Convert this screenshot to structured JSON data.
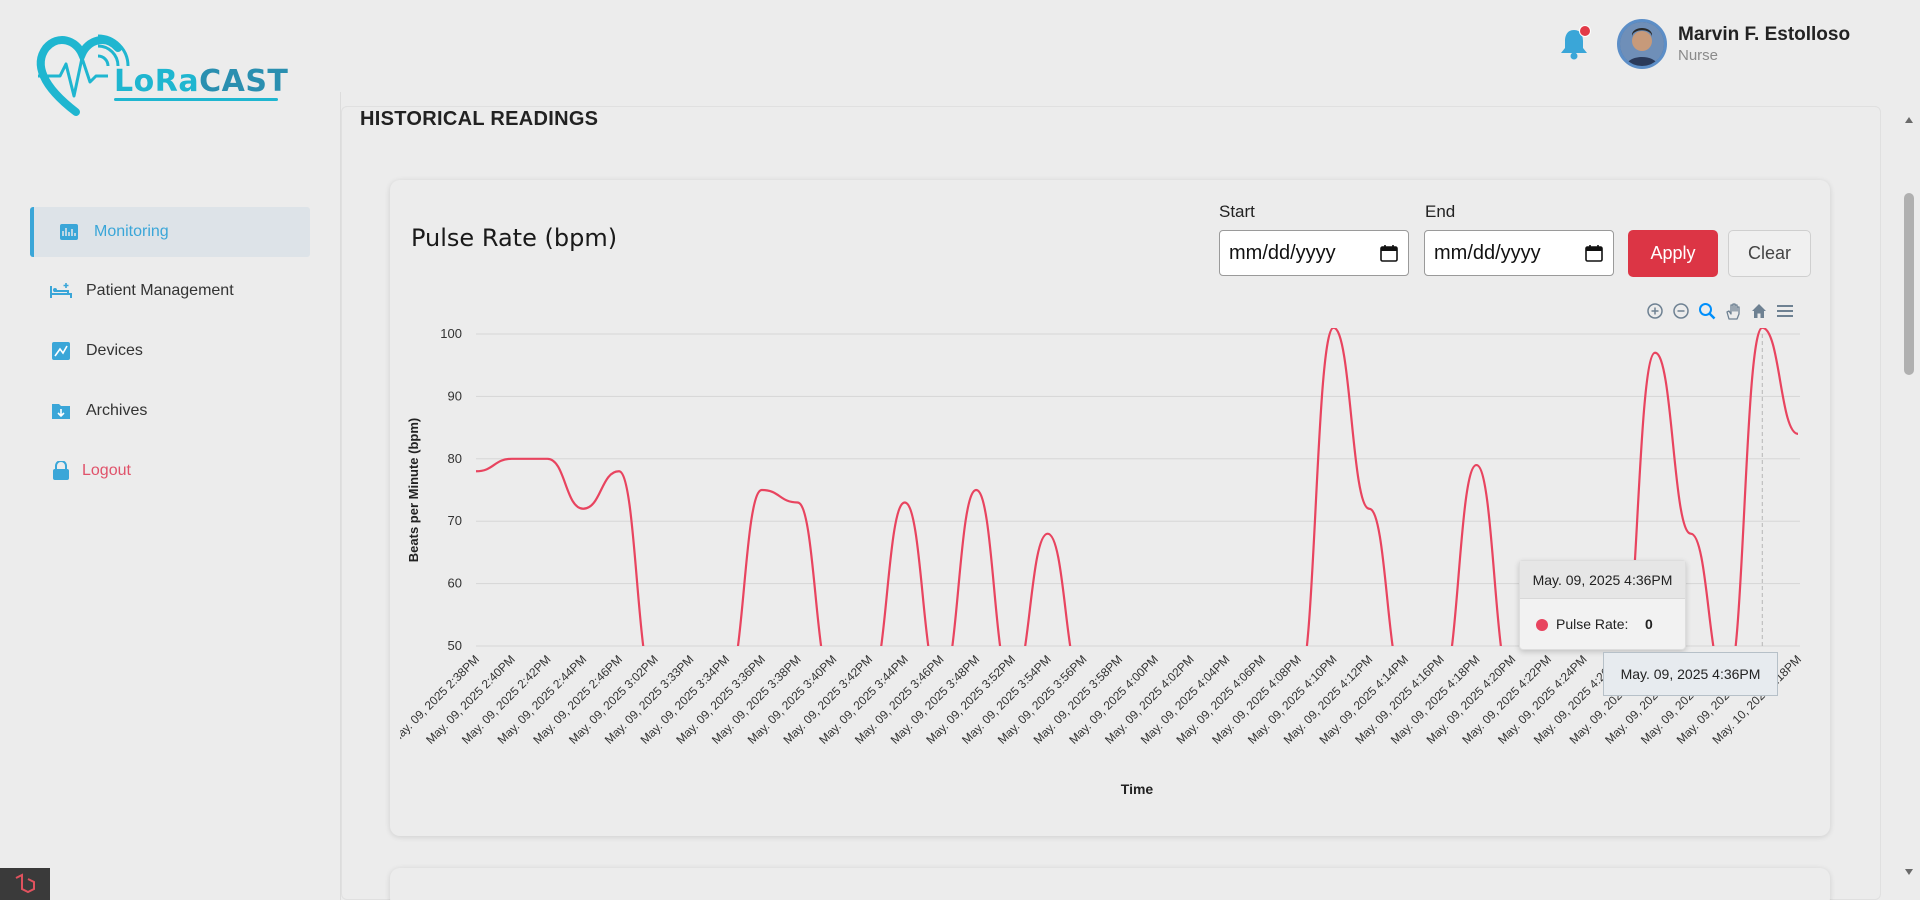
{
  "brand": {
    "name_part1": "LoRa",
    "name_part2": "CAST"
  },
  "sidebar": {
    "items": [
      {
        "label": "Monitoring",
        "icon": "monitor-chart-icon",
        "active": true
      },
      {
        "label": "Patient Management",
        "icon": "bed-plus-icon"
      },
      {
        "label": "Devices",
        "icon": "devices-icon"
      },
      {
        "label": "Archives",
        "icon": "archive-icon"
      },
      {
        "label": "Logout",
        "icon": "lock-icon"
      }
    ]
  },
  "header": {
    "user_name": "Marvin F. Estolloso",
    "user_role": "Nurse",
    "notification_icon": "bell-icon",
    "notification_badge_color": "#e23a48"
  },
  "section": {
    "title": "HISTORICAL READINGS"
  },
  "card": {
    "title": "Pulse Rate (bpm)",
    "start_label": "Start",
    "end_label": "End",
    "start_placeholder": "mm/dd/yyyy",
    "end_placeholder": "mm/dd/yyyy",
    "apply_label": "Apply",
    "clear_label": "Clear",
    "apply_color": "#dc3545"
  },
  "toolbar": [
    "zoom-in-icon",
    "zoom-out-icon",
    "zoom-selection-icon",
    "pan-hand-icon",
    "home-reset-icon",
    "menu-icon"
  ],
  "tooltip": {
    "title": "May. 09, 2025 4:36PM",
    "series_label": "Pulse Rate:",
    "value": "0",
    "x_label": "May. 09, 2025 4:36PM"
  },
  "chart_data": {
    "type": "line",
    "title": "",
    "xlabel": "Time",
    "ylabel": "Beats per Minute (bpm)",
    "ylim": [
      50,
      100
    ],
    "yticks": [
      50,
      60,
      70,
      80,
      90,
      100
    ],
    "grid": true,
    "line_color": "#e8445f",
    "categories": [
      "May. 09, 2025 2:38PM",
      "May. 09, 2025 2:40PM",
      "May. 09, 2025 2:42PM",
      "May. 09, 2025 2:44PM",
      "May. 09, 2025 2:46PM",
      "May. 09, 2025 3:02PM",
      "May. 09, 2025 3:33PM",
      "May. 09, 2025 3:34PM",
      "May. 09, 2025 3:36PM",
      "May. 09, 2025 3:38PM",
      "May. 09, 2025 3:40PM",
      "May. 09, 2025 3:42PM",
      "May. 09, 2025 3:44PM",
      "May. 09, 2025 3:46PM",
      "May. 09, 2025 3:48PM",
      "May. 09, 2025 3:52PM",
      "May. 09, 2025 3:54PM",
      "May. 09, 2025 3:56PM",
      "May. 09, 2025 3:58PM",
      "May. 09, 2025 4:00PM",
      "May. 09, 2025 4:02PM",
      "May. 09, 2025 4:04PM",
      "May. 09, 2025 4:06PM",
      "May. 09, 2025 4:08PM",
      "May. 09, 2025 4:10PM",
      "May. 09, 2025 4:12PM",
      "May. 09, 2025 4:14PM",
      "May. 09, 2025 4:16PM",
      "May. 09, 2025 4:18PM",
      "May. 09, 2025 4:20PM",
      "May. 09, 2025 4:22PM",
      "May. 09, 2025 4:24PM",
      "May. 09, 2025 4:26PM",
      "May. 09, 2025 4:28PM",
      "May. 09, 2025 4:32PM",
      "May. 09, 2025 4:34PM",
      "May. 09, 2025 4:36PM",
      "May. 10, 2025 2:18PM"
    ],
    "series": [
      {
        "name": "Pulse Rate",
        "values": [
          78,
          80,
          80,
          72,
          78,
          0,
          0,
          0,
          75,
          73,
          0,
          0,
          73,
          0,
          75,
          0,
          68,
          0,
          0,
          0,
          0,
          0,
          0,
          0,
          101,
          72,
          0,
          0,
          79,
          0,
          0,
          0,
          0,
          97,
          68,
          0,
          101,
          84
        ]
      }
    ]
  }
}
